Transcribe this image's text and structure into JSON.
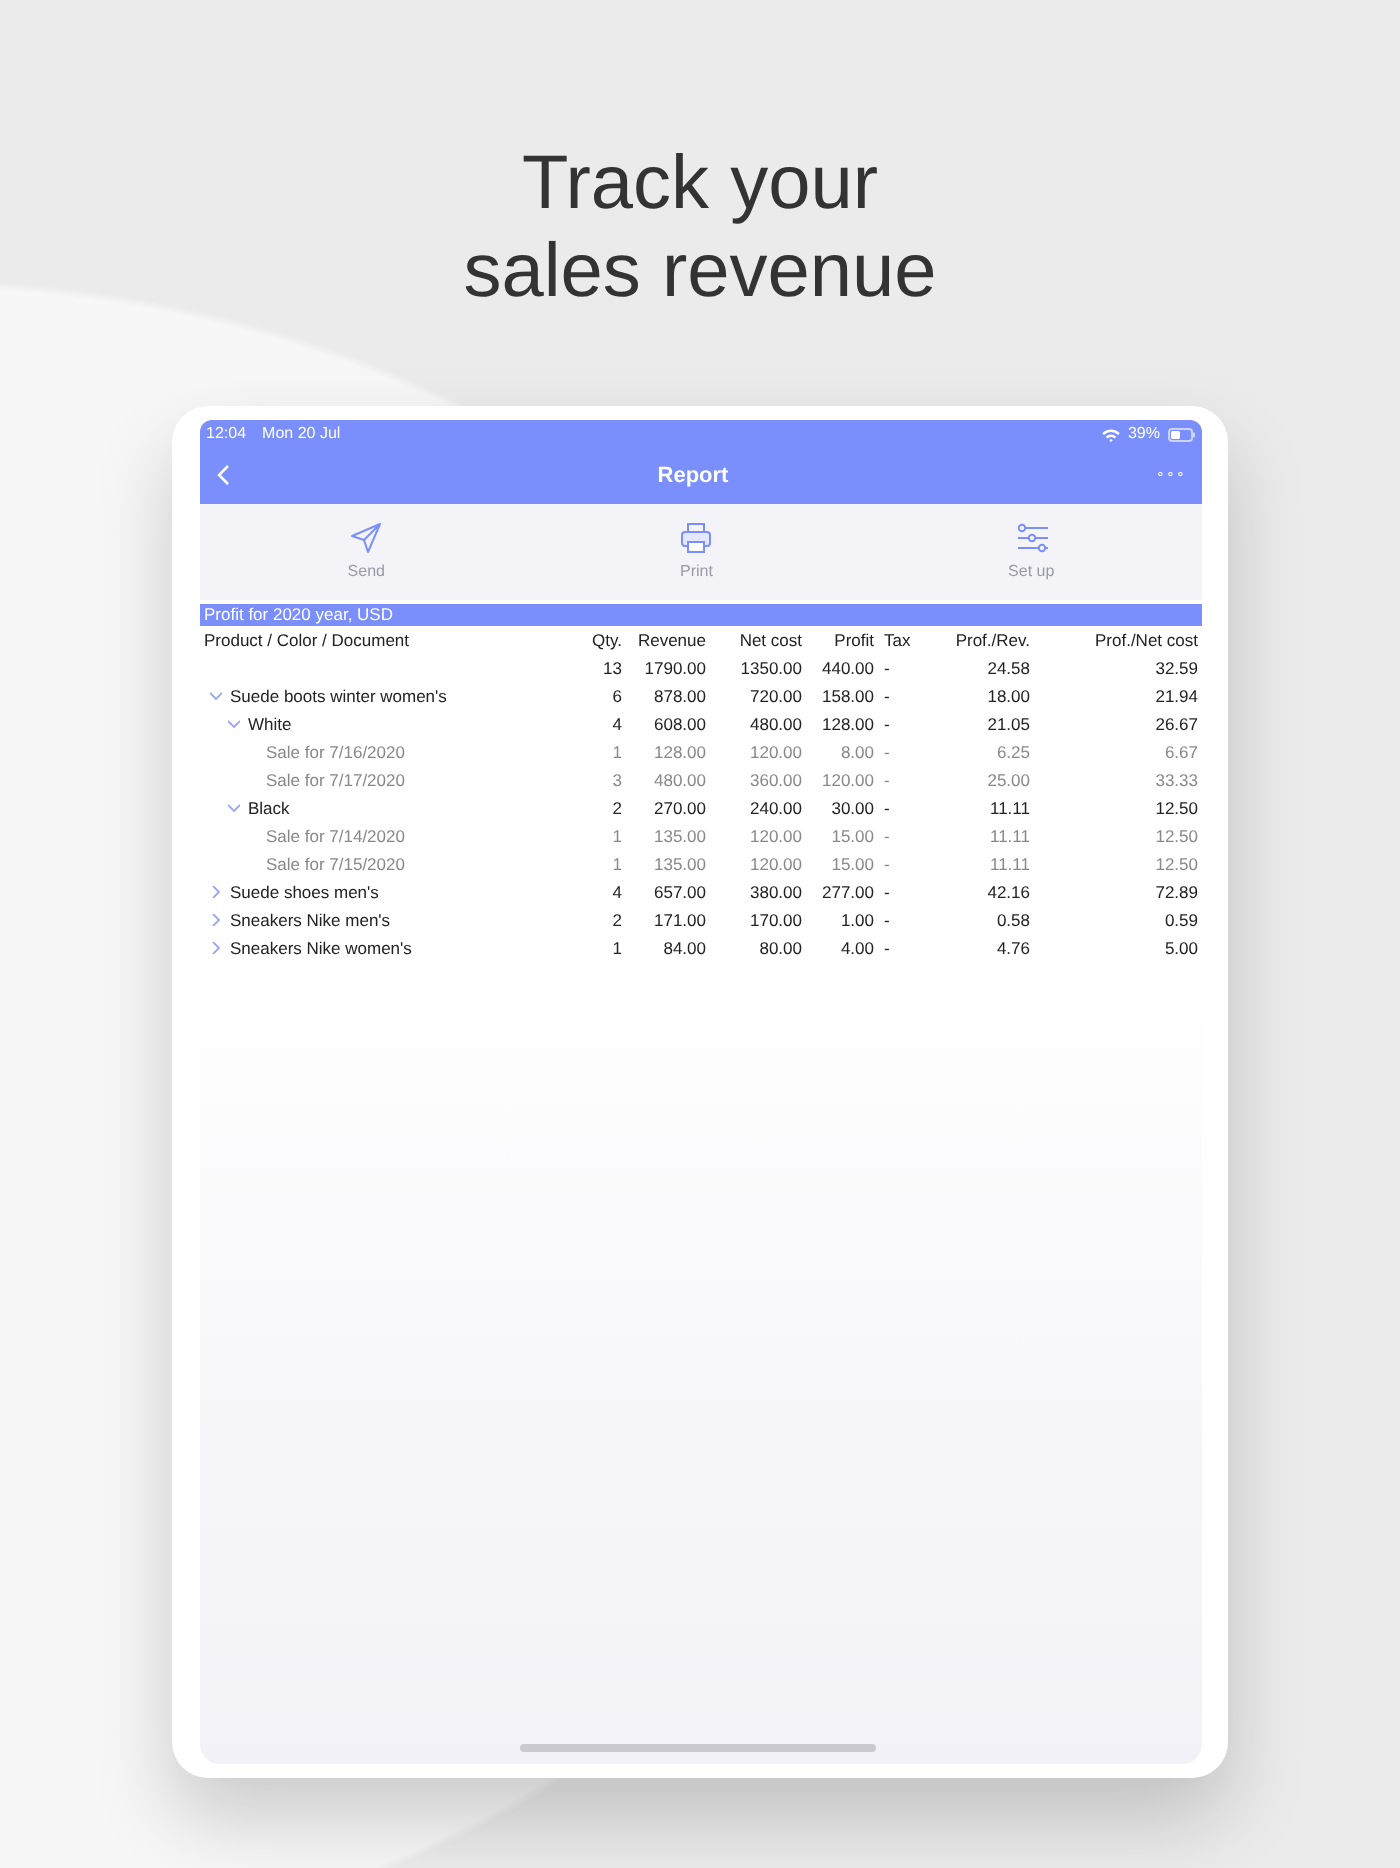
{
  "headline": [
    "Track your",
    "sales revenue"
  ],
  "status_bar": {
    "time": "12:04",
    "date": "Mon 20 Jul",
    "battery": "39%"
  },
  "nav": {
    "title": "Report",
    "more": "∘∘∘"
  },
  "toolbar": [
    {
      "kind": "send",
      "label": "Send"
    },
    {
      "kind": "print",
      "label": "Print"
    },
    {
      "kind": "setup",
      "label": "Set up"
    }
  ],
  "report": {
    "title": "Profit for 2020 year, USD",
    "columns": [
      "Product / Color / Document",
      "Qty.",
      "Revenue",
      "Net cost",
      "Profit",
      "Tax",
      "Prof./Rev.",
      "Prof./Net cost"
    ],
    "total": [
      "13",
      "1790.00",
      "1350.00",
      "440.00",
      "-",
      "24.58",
      "32.59"
    ],
    "rows": [
      {
        "kind": "group",
        "expanded": true,
        "cells": [
          "Suede boots winter women's",
          "6",
          "878.00",
          "720.00",
          "158.00",
          "-",
          "18.00",
          "21.94"
        ],
        "children": [
          {
            "kind": "group",
            "expanded": true,
            "cells": [
              "White",
              "4",
              "608.00",
              "480.00",
              "128.00",
              "-",
              "21.05",
              "26.67"
            ],
            "children": [
              {
                "kind": "document",
                "cells": [
                  "Sale for 7/16/2020",
                  "1",
                  "128.00",
                  "120.00",
                  "8.00",
                  "-",
                  "6.25",
                  "6.67"
                ]
              },
              {
                "kind": "document",
                "cells": [
                  "Sale for 7/17/2020",
                  "3",
                  "480.00",
                  "360.00",
                  "120.00",
                  "-",
                  "25.00",
                  "33.33"
                ]
              }
            ]
          },
          {
            "kind": "group",
            "expanded": true,
            "cells": [
              "Black",
              "2",
              "270.00",
              "240.00",
              "30.00",
              "-",
              "11.11",
              "12.50"
            ],
            "children": [
              {
                "kind": "document",
                "cells": [
                  "Sale for 7/14/2020",
                  "1",
                  "135.00",
                  "120.00",
                  "15.00",
                  "-",
                  "11.11",
                  "12.50"
                ]
              },
              {
                "kind": "document",
                "cells": [
                  "Sale for 7/15/2020",
                  "1",
                  "135.00",
                  "120.00",
                  "15.00",
                  "-",
                  "11.11",
                  "12.50"
                ]
              }
            ]
          }
        ]
      },
      {
        "kind": "group",
        "expanded": false,
        "cells": [
          "Suede shoes men's",
          "4",
          "657.00",
          "380.00",
          "277.00",
          "-",
          "42.16",
          "72.89"
        ]
      },
      {
        "kind": "group",
        "expanded": false,
        "cells": [
          "Sneakers Nike men's",
          "2",
          "171.00",
          "170.00",
          "1.00",
          "-",
          "0.58",
          "0.59"
        ]
      },
      {
        "kind": "group",
        "expanded": false,
        "cells": [
          "Sneakers Nike women's",
          "1",
          "84.00",
          "80.00",
          "4.00",
          "-",
          "4.76",
          "5.00"
        ]
      }
    ]
  }
}
